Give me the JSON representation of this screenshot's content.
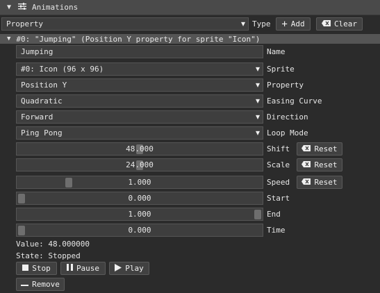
{
  "panel": {
    "title": "Animations"
  },
  "toolbar": {
    "type_select": "Property",
    "type_label": "Type",
    "add_label": "Add",
    "clear_label": "Clear"
  },
  "animation": {
    "header": "#0: \"Jumping\" (Position Y property for sprite \"Icon\")",
    "name_value": "Jumping",
    "name_label": "Name",
    "sprite_value": "#0: Icon (96 x 96)",
    "sprite_label": "Sprite",
    "property_value": "Position Y",
    "property_label": "Property",
    "easing_value": "Quadratic",
    "easing_label": "Easing Curve",
    "direction_value": "Forward",
    "direction_label": "Direction",
    "loop_value": "Ping Pong",
    "loop_label": "Loop Mode",
    "shift": {
      "value": "48.000",
      "label": "Shift",
      "level": 0.5
    },
    "scale": {
      "value": "24.000",
      "label": "Scale",
      "level": 0.5
    },
    "speed": {
      "value": "1.000",
      "label": "Speed",
      "level": 0.2
    },
    "start": {
      "value": "0.000",
      "label": "Start",
      "level": 0.0
    },
    "end": {
      "value": "1.000",
      "label": "End",
      "level": 1.0
    },
    "time": {
      "value": "0.000",
      "label": "Time",
      "level": 0.0
    },
    "reset_label": "Reset",
    "value_text": "Value: 48.000000",
    "state_text": "State: Stopped",
    "stop_label": "Stop",
    "pause_label": "Pause",
    "play_label": "Play",
    "remove_label": "Remove"
  },
  "colors": {
    "background": "#2b2b2b",
    "header": "#4a4a4a",
    "field": "#3e3e3e",
    "grab": "#6e6e6e"
  }
}
